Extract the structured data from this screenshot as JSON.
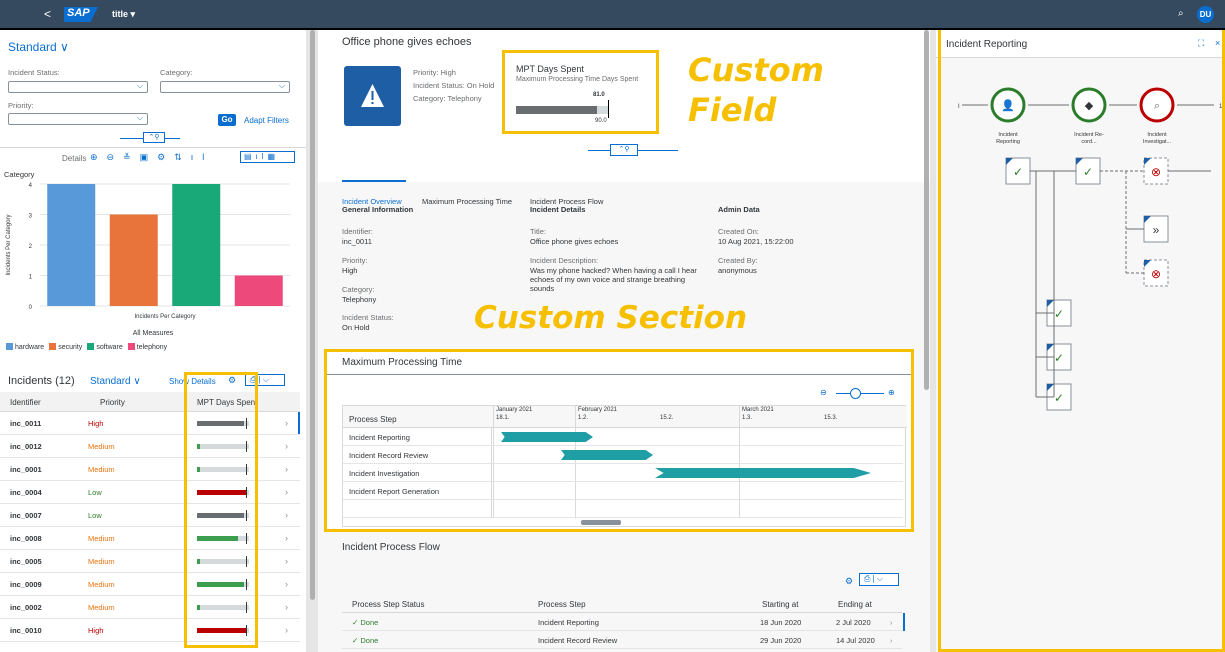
{
  "shell": {
    "back": "<",
    "logo": "SAP",
    "title": "title ▾",
    "search": "⌕",
    "avatar": "DU"
  },
  "left": {
    "variant": "Standard ∨",
    "filters": {
      "status_label": "Incident Status:",
      "category_label": "Category:",
      "priority_label": "Priority:",
      "go": "Go",
      "adapt": "Adapt Filters"
    },
    "chart_toolbar": {
      "details": "Details"
    },
    "chart_data": {
      "type": "bar",
      "title": "Category",
      "xlabel": "Incidents Per Category",
      "ylabel": "Incidents Per Category",
      "categories": [
        "hardware",
        "security",
        "software",
        "telephony"
      ],
      "values": [
        4,
        3,
        4,
        1
      ],
      "ylim": [
        0,
        4
      ],
      "yticks": [
        "4",
        "3",
        "2",
        "1",
        "0"
      ],
      "colors": [
        "#5899da",
        "#e8743b",
        "#19a979",
        "#ed4a7b"
      ],
      "legend_title": "All Measures"
    },
    "table": {
      "title": "Incidents (12)",
      "variant": "Standard ∨",
      "show_details": "Show Details",
      "headers": [
        "Identifier",
        "Priority",
        "MPT Days Spent"
      ],
      "rows": [
        {
          "id": "inc_0011",
          "priority": "High",
          "pcolor": "#bb0000",
          "fill": 0.9,
          "fcolor": "#6a6d70"
        },
        {
          "id": "inc_0012",
          "priority": "Medium",
          "pcolor": "#e9730c",
          "fill": 0.05,
          "fcolor": "#3d9e50"
        },
        {
          "id": "inc_0001",
          "priority": "Medium",
          "pcolor": "#e9730c",
          "fill": 0.05,
          "fcolor": "#3d9e50"
        },
        {
          "id": "inc_0004",
          "priority": "Low",
          "pcolor": "#2b7d2b",
          "fill": 0.96,
          "fcolor": "#bb0000"
        },
        {
          "id": "inc_0007",
          "priority": "Low",
          "pcolor": "#2b7d2b",
          "fill": 0.9,
          "fcolor": "#6a6d70"
        },
        {
          "id": "inc_0008",
          "priority": "Medium",
          "pcolor": "#e9730c",
          "fill": 0.78,
          "fcolor": "#3d9e50"
        },
        {
          "id": "inc_0005",
          "priority": "Medium",
          "pcolor": "#e9730c",
          "fill": 0.05,
          "fcolor": "#3d9e50"
        },
        {
          "id": "inc_0009",
          "priority": "Medium",
          "pcolor": "#e9730c",
          "fill": 0.9,
          "fcolor": "#3d9e50"
        },
        {
          "id": "inc_0002",
          "priority": "Medium",
          "pcolor": "#e9730c",
          "fill": 0.05,
          "fcolor": "#3d9e50"
        },
        {
          "id": "inc_0010",
          "priority": "High",
          "pcolor": "#bb0000",
          "fill": 0.96,
          "fcolor": "#bb0000"
        }
      ]
    }
  },
  "mid": {
    "title": "Office phone gives echoes",
    "priority": "Priority: High",
    "status": "Incident Status: On Hold",
    "category": "Category: Telephony",
    "mpt": {
      "title": "MPT Days Spent",
      "sub": "Maximum Processing Time Days Spent",
      "value": "81.0",
      "target": "90.0"
    },
    "custom_field": "Custom\nField",
    "tabs": [
      "Incident Overview",
      "Maximum Processing Time",
      "Incident Process Flow"
    ],
    "gi": {
      "head": "General Information",
      "id_l": "Identifier:",
      "id_v": "inc_0011",
      "pr_l": "Priority:",
      "pr_v": "High",
      "cat_l": "Category:",
      "cat_v": "Telephony",
      "st_l": "Incident Status:",
      "st_v": "On Hold"
    },
    "det": {
      "head": "Incident Details",
      "t_l": "Title:",
      "t_v": "Office phone gives echoes",
      "d_l": "Incident Description:",
      "d_v": "Was my phone hacked? When having a call I hear echoes of my own voice and strange breathing sounds"
    },
    "adm": {
      "head": "Admin Data",
      "c_l": "Created On:",
      "c_v": "10 Aug 2021, 15:22:00",
      "b_l": "Created By:",
      "b_v": "anonymous"
    },
    "custom_section": "Custom Section",
    "mpt_section": {
      "title": "Maximum Processing Time",
      "col": "Process Step",
      "months": [
        "January 2021",
        "February 2021",
        "March 2021"
      ],
      "days": [
        "18.1.",
        "1.2.",
        "15.2.",
        "1.3.",
        "15.3."
      ],
      "steps": [
        "Incident Reporting",
        "Incident Record Review",
        "Incident Investigation",
        "Incident Report Generation"
      ]
    },
    "flow": {
      "title": "Incident Process Flow",
      "headers": [
        "Process Step Status",
        "Process Step",
        "Starting at",
        "Ending at"
      ],
      "rows": [
        {
          "status": "Done",
          "step": "Incident Reporting",
          "start": "18 Jun 2020",
          "end": "2 Jul 2020"
        },
        {
          "status": "Done",
          "step": "Incident Record Review",
          "start": "29 Jun 2020",
          "end": "14 Jul 2020"
        }
      ]
    }
  },
  "right": {
    "title": "Incident Reporting",
    "nodes": [
      "Incident\nReporting",
      "Incident Re-\ncord...",
      "Incident\nInvestigat..."
    ],
    "badge": "1"
  }
}
